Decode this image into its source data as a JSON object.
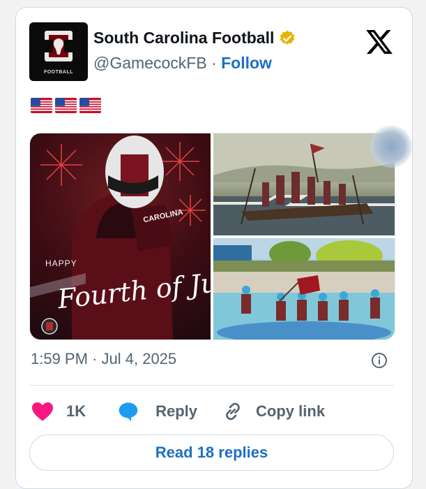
{
  "author": {
    "name": "South Carolina Football",
    "handle": "@GamecockFB",
    "separator": "·",
    "follow_label": "Follow",
    "avatar_label": "FOOTBALL",
    "verified_color": "#e8b300"
  },
  "post": {
    "text_icons": [
      "us-flag",
      "us-flag",
      "us-flag"
    ],
    "media": [
      {
        "name": "happy-fourth-of-july-graphic",
        "happy": "HAPPY",
        "title": "Fourth of July",
        "jersey": "CAROLINA"
      },
      {
        "name": "washington-crossing-painting"
      },
      {
        "name": "players-rafting-photo"
      }
    ],
    "time": "1:59 PM",
    "date_sep": "·",
    "date": "Jul 4, 2025"
  },
  "actions": {
    "like_count": "1K",
    "reply_label": "Reply",
    "copy_label": "Copy link",
    "read_replies_label": "Read 18 replies"
  },
  "colors": {
    "like": "#f91880",
    "reply": "#1d9bf0",
    "link": "#1d6fc2"
  }
}
